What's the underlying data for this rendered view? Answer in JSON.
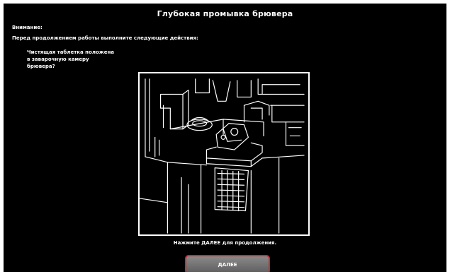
{
  "screen": {
    "title": "Глубокая промывка брювера",
    "warning_label": "Внимание:",
    "warning_instruction": "Перед продолжением работы выполните следующие действия:",
    "question": "Чистящая таблетка положена\nв заварочную камеру\nбрювера?",
    "illustration_icon": "coffee-machine-brewer-chamber-illustration",
    "prompt": "Нажмите ДАЛЕЕ для продолжения.",
    "next_button_label": "ДАЛЕЕ"
  },
  "colors": {
    "background": "#000000",
    "text": "#ffffff",
    "button_border": "#b8323a",
    "button_fill": "#707070"
  }
}
